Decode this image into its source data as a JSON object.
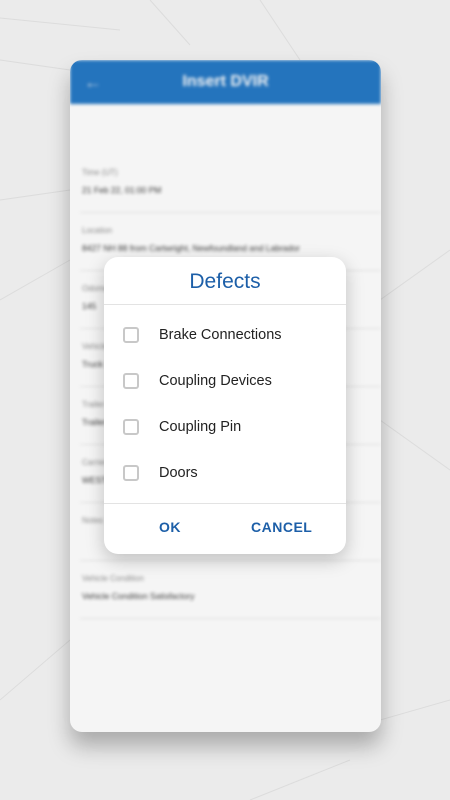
{
  "app": {
    "title": "Insert DVIR",
    "back_icon": "arrow-left-icon",
    "accent_color": "#1b72c2"
  },
  "form": {
    "fields": [
      {
        "label": "Time (UT)",
        "value": "21 Feb 22, 01:00 PM"
      },
      {
        "label": "Location",
        "value": "8427 NH 88 from Cartwright, Newfoundland and Labrador"
      },
      {
        "label": "Odometer",
        "value": "145"
      },
      {
        "label": "Vehicle",
        "value": "Truck 1"
      },
      {
        "label": "Trailer",
        "value": "Trailer 1"
      },
      {
        "label": "Carrier",
        "value": "WEST"
      },
      {
        "label": "Notes",
        "value": ""
      },
      {
        "label": "Vehicle Condition",
        "value": "Vehicle Condition Satisfactory"
      }
    ]
  },
  "dialog": {
    "title": "Defects",
    "options": [
      {
        "label": "Brake Connections",
        "checked": false
      },
      {
        "label": "Coupling Devices",
        "checked": false
      },
      {
        "label": "Coupling Pin",
        "checked": false
      },
      {
        "label": "Doors",
        "checked": false
      }
    ],
    "ok_label": "OK",
    "cancel_label": "CANCEL",
    "title_color": "#1d5fa8"
  }
}
